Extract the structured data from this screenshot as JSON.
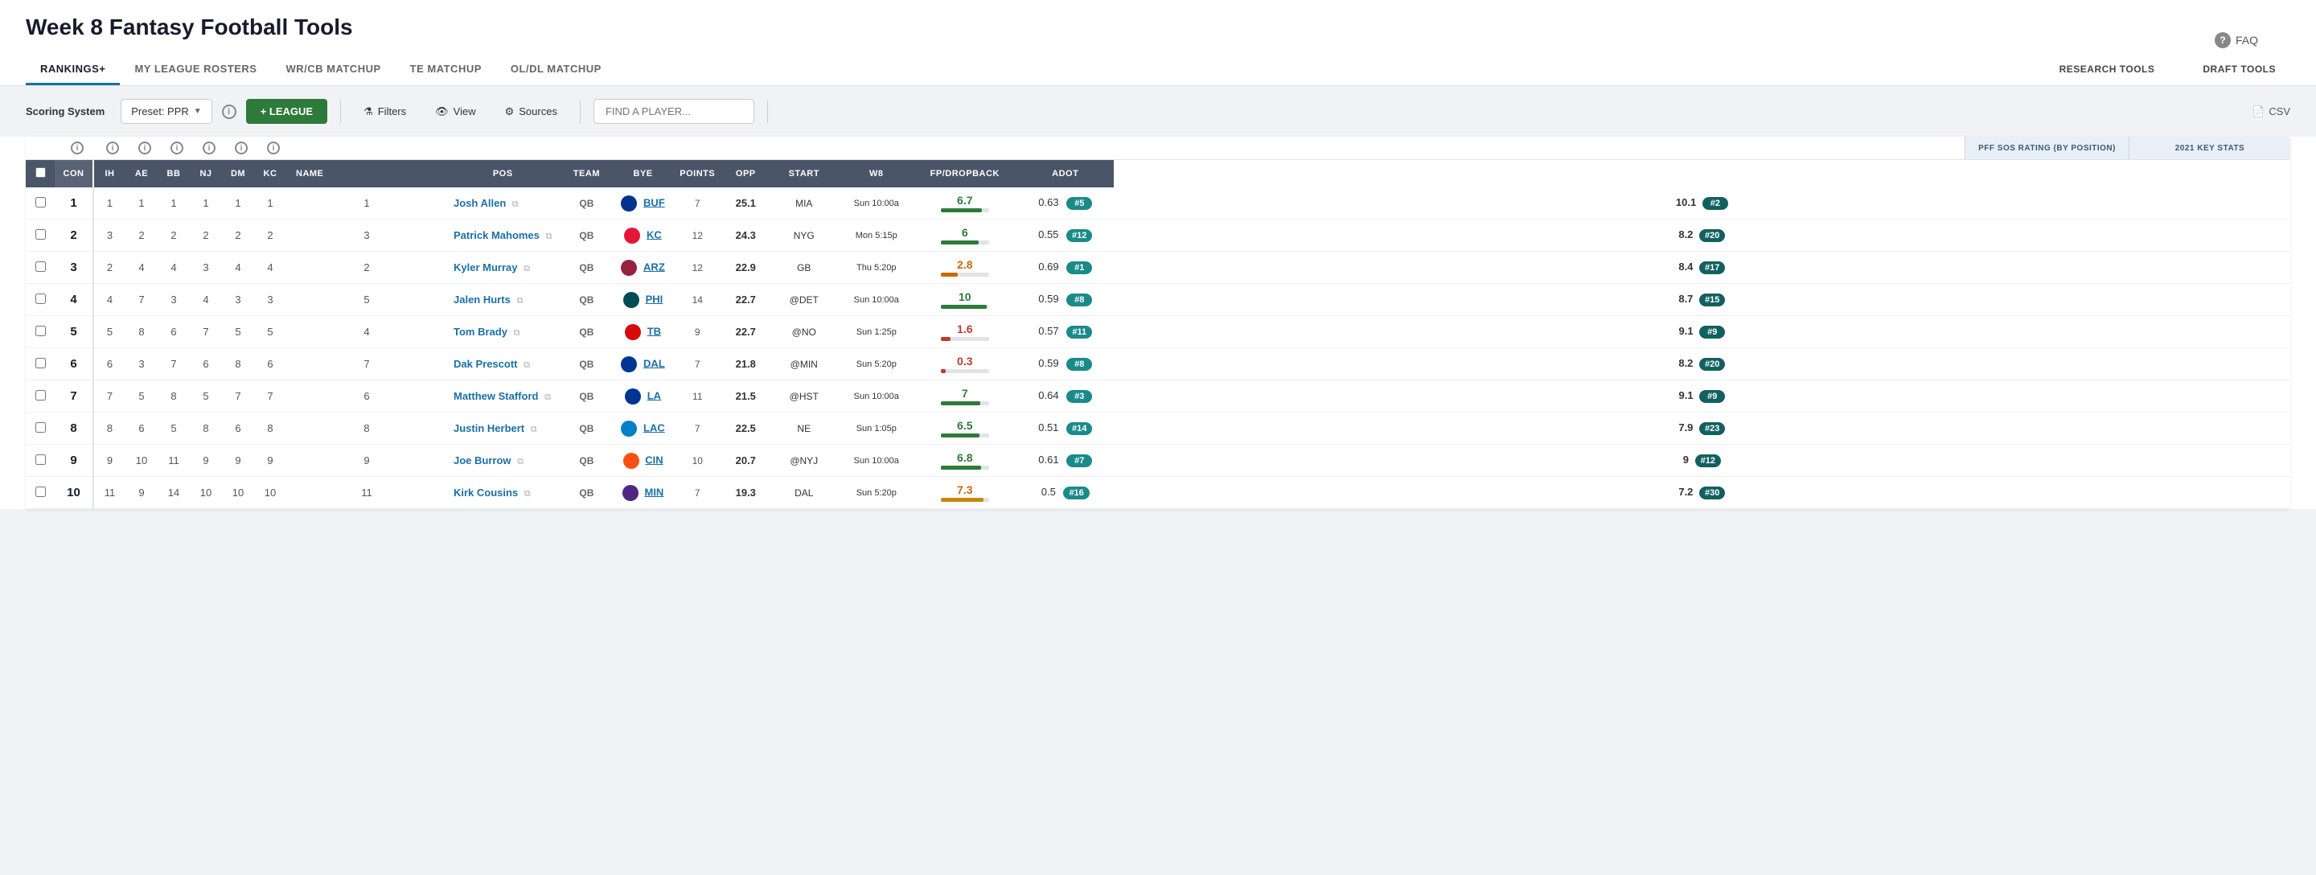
{
  "page": {
    "title": "Week 8 Fantasy Football Tools",
    "faq": "FAQ"
  },
  "nav": {
    "tabs": [
      {
        "label": "RANKINGS+",
        "active": true
      },
      {
        "label": "MY LEAGUE ROSTERS",
        "active": false
      },
      {
        "label": "WR/CB MATCHUP",
        "active": false
      },
      {
        "label": "TE MATCHUP",
        "active": false
      },
      {
        "label": "OL/DL MATCHUP",
        "active": false
      }
    ],
    "right_tabs": [
      {
        "label": "RESEARCH TOOLS"
      },
      {
        "label": "DRAFT TOOLS"
      }
    ]
  },
  "toolbar": {
    "scoring_label": "Scoring System",
    "scoring_preset": "Preset: PPR",
    "league_btn": "+ LEAGUE",
    "filters_btn": "Filters",
    "view_btn": "View",
    "sources_btn": "Sources",
    "search_placeholder": "FIND A PLAYER...",
    "csv_btn": "CSV"
  },
  "table": {
    "meta_left_header": "",
    "pff_sos_header": "PFF SOS RATING (BY POSITION)",
    "key_stats_header": "2021 KEY STATS",
    "columns": [
      "CON",
      "IH",
      "AE",
      "BB",
      "NJ",
      "DM",
      "KC",
      "NAME",
      "POS",
      "TEAM",
      "BYE",
      "POINTS",
      "OPP",
      "START",
      "W8",
      "FP/DROPBACK",
      "ADOT"
    ],
    "rows": [
      {
        "rank": 1,
        "con": 1,
        "ih": 1,
        "ae": 1,
        "bb": 1,
        "nj": 1,
        "dm": 1,
        "kc": 1,
        "name": "Josh Allen",
        "pos": "QB",
        "team": "BUF",
        "team_color": "#00338D",
        "bye": 7,
        "points": 25.1,
        "opp": "MIA",
        "start": "Sun 10:00a",
        "w8": 6.7,
        "w8_color": "green",
        "bar_pct": 85,
        "bar_color": "#2d7a3a",
        "fp": 0.63,
        "fp_rank": "#5",
        "fp_rank_color": "#1a8a8a",
        "adot": 10.1,
        "adot_rank": "#2",
        "adot_rank_color": "#126060"
      },
      {
        "rank": 2,
        "con": 3,
        "ih": 2,
        "ae": 2,
        "bb": 2,
        "nj": 2,
        "dm": 2,
        "kc": 3,
        "name": "Patrick Mahomes",
        "pos": "QB",
        "team": "KC",
        "team_color": "#E31837",
        "bye": 12,
        "points": 24.3,
        "opp": "NYG",
        "start": "Mon 5:15p",
        "w8": 6.0,
        "w8_color": "green",
        "bar_pct": 78,
        "bar_color": "#2d7a3a",
        "fp": 0.55,
        "fp_rank": "#12",
        "fp_rank_color": "#1a8a8a",
        "adot": 8.2,
        "adot_rank": "#20",
        "adot_rank_color": "#126060"
      },
      {
        "rank": 3,
        "con": 2,
        "ih": 4,
        "ae": 4,
        "bb": 3,
        "nj": 4,
        "dm": 4,
        "kc": 2,
        "name": "Kyler Murray",
        "pos": "QB",
        "team": "ARZ",
        "team_color": "#97233F",
        "bye": 12,
        "points": 22.9,
        "opp": "GB",
        "start": "Thu 5:20p",
        "w8": 2.8,
        "w8_color": "orange",
        "bar_pct": 35,
        "bar_color": "#c96a00",
        "fp": 0.69,
        "fp_rank": "#1",
        "fp_rank_color": "#1a8a8a",
        "adot": 8.4,
        "adot_rank": "#17",
        "adot_rank_color": "#126060"
      },
      {
        "rank": 4,
        "con": 4,
        "ih": 7,
        "ae": 3,
        "bb": 4,
        "nj": 3,
        "dm": 3,
        "kc": 5,
        "name": "Jalen Hurts",
        "pos": "QB",
        "team": "PHI",
        "team_color": "#004C54",
        "bye": 14,
        "points": 22.7,
        "opp": "@DET",
        "start": "Sun 10:00a",
        "w8": 10.0,
        "w8_color": "green",
        "bar_pct": 95,
        "bar_color": "#2d7a3a",
        "fp": 0.59,
        "fp_rank": "#8",
        "fp_rank_color": "#1a8a8a",
        "adot": 8.7,
        "adot_rank": "#15",
        "adot_rank_color": "#126060"
      },
      {
        "rank": 5,
        "con": 5,
        "ih": 8,
        "ae": 6,
        "bb": 7,
        "nj": 5,
        "dm": 5,
        "kc": 4,
        "name": "Tom Brady",
        "pos": "QB",
        "team": "TB",
        "team_color": "#D50A0A",
        "bye": 9,
        "points": 22.7,
        "opp": "@NO",
        "start": "Sun 1:25p",
        "w8": 1.6,
        "w8_color": "red",
        "bar_pct": 20,
        "bar_color": "#c0392b",
        "fp": 0.57,
        "fp_rank": "#11",
        "fp_rank_color": "#1a8a8a",
        "adot": 9.1,
        "adot_rank": "#9",
        "adot_rank_color": "#126060"
      },
      {
        "rank": 6,
        "con": 6,
        "ih": 3,
        "ae": 7,
        "bb": 6,
        "nj": 8,
        "dm": 6,
        "kc": 7,
        "name": "Dak Prescott",
        "pos": "QB",
        "team": "DAL",
        "team_color": "#003594",
        "bye": 7,
        "points": 21.8,
        "opp": "@MIN",
        "start": "Sun 5:20p",
        "w8": 0.3,
        "w8_color": "red",
        "bar_pct": 10,
        "bar_color": "#c0392b",
        "fp": 0.59,
        "fp_rank": "#8",
        "fp_rank_color": "#1a8a8a",
        "adot": 8.2,
        "adot_rank": "#20",
        "adot_rank_color": "#126060"
      },
      {
        "rank": 7,
        "con": 7,
        "ih": 5,
        "ae": 8,
        "bb": 5,
        "nj": 7,
        "dm": 7,
        "kc": 6,
        "name": "Matthew Stafford",
        "pos": "QB",
        "team": "LA",
        "team_color": "#003594",
        "bye": 11,
        "points": 21.5,
        "opp": "@HST",
        "start": "Sun 10:00a",
        "w8": 7.0,
        "w8_color": "green",
        "bar_pct": 82,
        "bar_color": "#2d7a3a",
        "fp": 0.64,
        "fp_rank": "#3",
        "fp_rank_color": "#1a8a8a",
        "adot": 9.1,
        "adot_rank": "#9",
        "adot_rank_color": "#126060"
      },
      {
        "rank": 8,
        "con": 8,
        "ih": 6,
        "ae": 5,
        "bb": 8,
        "nj": 6,
        "dm": 8,
        "kc": 8,
        "name": "Justin Herbert",
        "pos": "QB",
        "team": "LAC",
        "team_color": "#0080C6",
        "bye": 7,
        "points": 22.5,
        "opp": "NE",
        "start": "Sun 1:05p",
        "w8": 6.5,
        "w8_color": "green",
        "bar_pct": 80,
        "bar_color": "#2d7a3a",
        "fp": 0.51,
        "fp_rank": "#14",
        "fp_rank_color": "#1a8a8a",
        "adot": 7.9,
        "adot_rank": "#23",
        "adot_rank_color": "#126060"
      },
      {
        "rank": 9,
        "con": 9,
        "ih": 10,
        "ae": 11,
        "bb": 9,
        "nj": 9,
        "dm": 9,
        "kc": 9,
        "name": "Joe Burrow",
        "pos": "QB",
        "team": "CIN",
        "team_color": "#FB4F14",
        "bye": 10,
        "points": 20.7,
        "opp": "@NYJ",
        "start": "Sun 10:00a",
        "w8": 6.8,
        "w8_color": "green",
        "bar_pct": 83,
        "bar_color": "#2d7a3a",
        "fp": 0.61,
        "fp_rank": "#7",
        "fp_rank_color": "#1a8a8a",
        "adot": 9.0,
        "adot_rank": "#12",
        "adot_rank_color": "#126060"
      },
      {
        "rank": 10,
        "con": 11,
        "ih": 9,
        "ae": 14,
        "bb": 10,
        "nj": 10,
        "dm": 10,
        "kc": 11,
        "name": "Kirk Cousins",
        "pos": "QB",
        "team": "MIN",
        "team_color": "#4F2683",
        "bye": 7,
        "points": 19.3,
        "opp": "DAL",
        "start": "Sun 5:20p",
        "w8": 7.3,
        "w8_color": "orange",
        "bar_pct": 88,
        "bar_color": "#c9870a",
        "fp": 0.5,
        "fp_rank": "#16",
        "fp_rank_color": "#1a8a8a",
        "adot": 7.2,
        "adot_rank": "#30",
        "adot_rank_color": "#126060"
      }
    ]
  }
}
